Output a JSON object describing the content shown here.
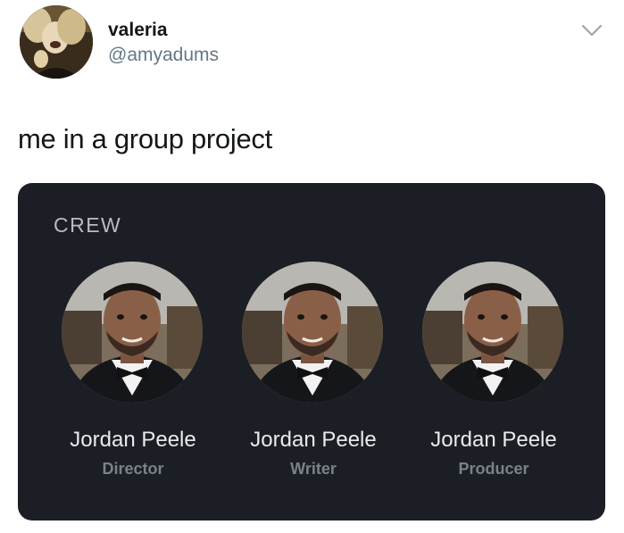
{
  "tweet": {
    "display_name": "valeria",
    "handle": "@amyadums",
    "text": "me in a group project"
  },
  "crew": {
    "heading": "CREW",
    "members": [
      {
        "name": "Jordan Peele",
        "role": "Director"
      },
      {
        "name": "Jordan Peele",
        "role": "Writer"
      },
      {
        "name": "Jordan Peele",
        "role": "Producer"
      }
    ]
  },
  "colors": {
    "card_background": "#1b1e24",
    "name_text": "#e9eaec",
    "role_text": "#7c8088",
    "handle_text": "#657786"
  },
  "icons": {
    "menu": "chevron-down-icon"
  }
}
